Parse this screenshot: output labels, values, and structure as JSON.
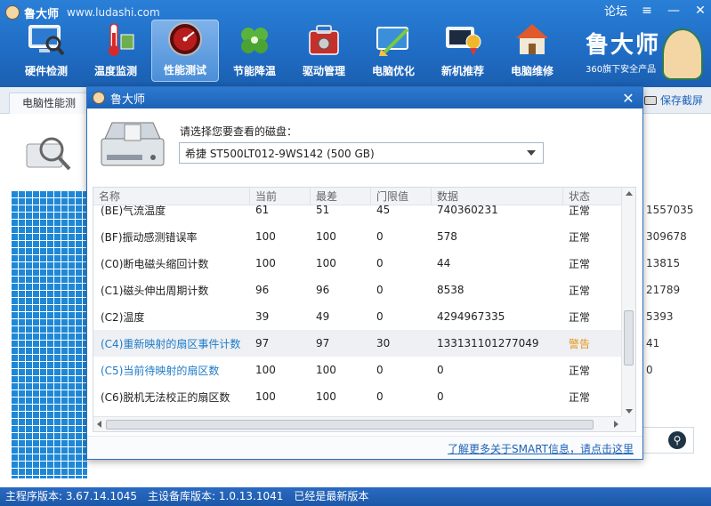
{
  "app": {
    "name": "鲁大师",
    "url": "www.ludashi.com"
  },
  "window_controls": {
    "forum": "论坛",
    "menu": "≡",
    "minimize": "—",
    "close": "✕"
  },
  "nav": [
    {
      "label": "硬件检测",
      "icon": "monitor-magnifier-icon"
    },
    {
      "label": "温度监测",
      "icon": "thermometer-icon"
    },
    {
      "label": "性能测试",
      "icon": "speedometer-icon",
      "active": true
    },
    {
      "label": "节能降温",
      "icon": "clover-icon"
    },
    {
      "label": "驱动管理",
      "icon": "toolbox-icon"
    },
    {
      "label": "电脑优化",
      "icon": "broom-icon"
    },
    {
      "label": "新机推荐",
      "icon": "award-medal-icon"
    },
    {
      "label": "电脑维修",
      "icon": "house-icon"
    }
  ],
  "brand_right": {
    "title": "鲁大师",
    "subtitle": "360旗下安全产品"
  },
  "subtab": {
    "label": "电脑性能测"
  },
  "save_screenshot": "保存截屏",
  "background_values": [
    "1557035",
    "309678",
    "13815",
    "21789",
    "5393",
    "41",
    "0"
  ],
  "dialog": {
    "title": "鲁大师",
    "disk_label": "请选择您要查看的磁盘：",
    "disk_selected": "希捷 ST500LT012-9WS142  (500 GB)",
    "columns": [
      "名称",
      "当前",
      "最差",
      "门限值",
      "数据",
      "状态"
    ],
    "rows": [
      {
        "name": "(BE)气流温度",
        "current": "61",
        "worst": "51",
        "threshold": "45",
        "data": "740360231",
        "status": "正常"
      },
      {
        "name": "(BF)振动感测错误率",
        "current": "100",
        "worst": "100",
        "threshold": "0",
        "data": "578",
        "status": "正常"
      },
      {
        "name": "(C0)断电磁头缩回计数",
        "current": "100",
        "worst": "100",
        "threshold": "0",
        "data": "44",
        "status": "正常"
      },
      {
        "name": "(C1)磁头伸出周期计数",
        "current": "96",
        "worst": "96",
        "threshold": "0",
        "data": "8538",
        "status": "正常"
      },
      {
        "name": "(C2)温度",
        "current": "39",
        "worst": "49",
        "threshold": "0",
        "data": "4294967335",
        "status": "正常"
      },
      {
        "name": "(C4)重新映射的扇区事件计数",
        "current": "97",
        "worst": "97",
        "threshold": "30",
        "data": "133131101277049",
        "status": "警告"
      },
      {
        "name": "(C5)当前待映射的扇区数",
        "current": "100",
        "worst": "100",
        "threshold": "0",
        "data": "0",
        "status": "正常"
      },
      {
        "name": "(C6)脱机无法校正的扇区数",
        "current": "100",
        "worst": "100",
        "threshold": "0",
        "data": "0",
        "status": "正常"
      }
    ],
    "smart_link": "了解更多关于SMART信息，请点击这里"
  },
  "statusbar": {
    "main_version": "主程序版本: 3.67.14.1045",
    "db_version": "主设备库版本: 1.0.13.1041",
    "latest": "已经是最新版本"
  },
  "colors": {
    "accent": "#1f6cc4",
    "link": "#1e62b8",
    "warning": "#e3951e",
    "highlight_name": "#1e7bc8"
  }
}
